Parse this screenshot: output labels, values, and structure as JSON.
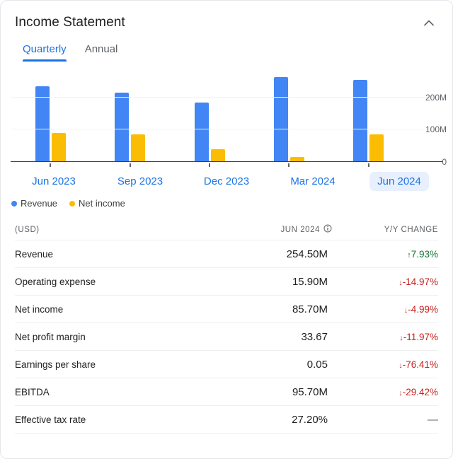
{
  "header": {
    "title": "Income Statement",
    "collapse_icon": "chevron-up-icon"
  },
  "tabs": [
    {
      "label": "Quarterly",
      "active": true
    },
    {
      "label": "Annual",
      "active": false
    }
  ],
  "legend": [
    {
      "label": "Revenue",
      "color": "#4285f4"
    },
    {
      "label": "Net income",
      "color": "#fbbc04"
    }
  ],
  "periods": [
    {
      "label": "Jun 2023",
      "selected": false
    },
    {
      "label": "Sep 2023",
      "selected": false
    },
    {
      "label": "Dec 2023",
      "selected": false
    },
    {
      "label": "Mar 2024",
      "selected": false
    },
    {
      "label": "Jun 2024",
      "selected": true
    }
  ],
  "chart_data": {
    "type": "bar",
    "title": "Income Statement",
    "xlabel": "",
    "ylabel": "",
    "ylim": [
      0,
      280000000
    ],
    "yticks": [
      0,
      100000000,
      200000000
    ],
    "ytick_labels": [
      "0",
      "100M",
      "200M"
    ],
    "grid": true,
    "legend_position": "bottom-left",
    "categories": [
      "Jun 2023",
      "Sep 2023",
      "Dec 2023",
      "Mar 2024",
      "Jun 2024"
    ],
    "series": [
      {
        "name": "Revenue",
        "color": "#4285f4",
        "values": [
          235000000,
          215000000,
          183000000,
          262000000,
          254500000
        ]
      },
      {
        "name": "Net income",
        "color": "#fbbc04",
        "values": [
          90000000,
          86000000,
          40000000,
          15000000,
          85700000
        ]
      }
    ]
  },
  "table": {
    "columns": {
      "currency": "(USD)",
      "period": "JUN 2024",
      "period_info_icon": "info-icon",
      "change": "Y/Y CHANGE"
    },
    "rows": [
      {
        "label": "Revenue",
        "value": "254.50M",
        "change": "7.93%",
        "arrow": "↑",
        "direction": "up"
      },
      {
        "label": "Operating expense",
        "value": "15.90M",
        "change": "-14.97%",
        "arrow": "↓",
        "direction": "down"
      },
      {
        "label": "Net income",
        "value": "85.70M",
        "change": "-4.99%",
        "arrow": "↓",
        "direction": "down"
      },
      {
        "label": "Net profit margin",
        "value": "33.67",
        "change": "-11.97%",
        "arrow": "↓",
        "direction": "down"
      },
      {
        "label": "Earnings per share",
        "value": "0.05",
        "change": "-76.41%",
        "arrow": "↓",
        "direction": "down"
      },
      {
        "label": "EBITDA",
        "value": "95.70M",
        "change": "-29.42%",
        "arrow": "↓",
        "direction": "down"
      },
      {
        "label": "Effective tax rate",
        "value": "27.20%",
        "change": "—",
        "arrow": "",
        "direction": "flat"
      }
    ]
  }
}
